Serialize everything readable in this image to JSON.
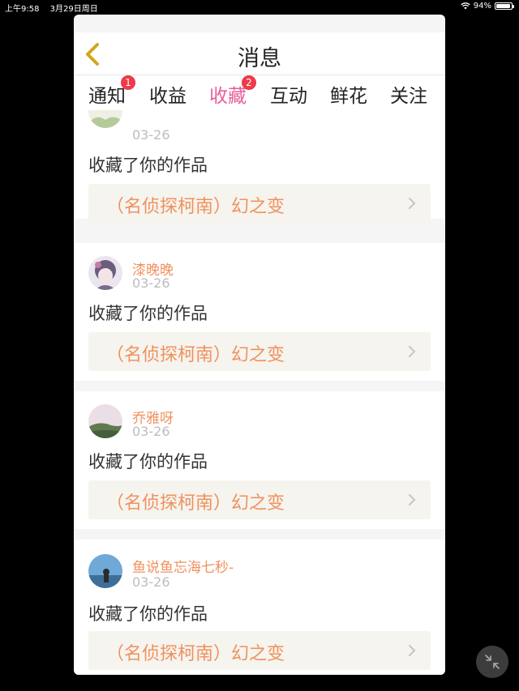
{
  "status_bar": {
    "time": "上午9:58",
    "date": "3月29日周日",
    "battery": "94%",
    "battery_level": 0.94,
    "icons": [
      "wifi-icon",
      "battery-icon"
    ]
  },
  "header": {
    "title": "消息",
    "back_icon": "chevron-left-icon"
  },
  "tabs": [
    {
      "label": "通知",
      "badge": "1",
      "active": false
    },
    {
      "label": "收益",
      "badge": null,
      "active": false
    },
    {
      "label": "收藏",
      "badge": "2",
      "active": true
    },
    {
      "label": "互动",
      "badge": null,
      "active": false
    },
    {
      "label": "鲜花",
      "badge": null,
      "active": false
    },
    {
      "label": "关注",
      "badge": null,
      "active": false
    }
  ],
  "items": [
    {
      "user": "",
      "date": "03-26",
      "text": "收藏了你的作品",
      "work": "（名侦探柯南）幻之变"
    },
    {
      "user": "漆晚晚",
      "date": "03-26",
      "text": "收藏了你的作品",
      "work": "（名侦探柯南）幻之变"
    },
    {
      "user": "乔雅呀",
      "date": "03-26",
      "text": "收藏了你的作品",
      "work": "（名侦探柯南）幻之变"
    },
    {
      "user": "鱼说鱼忘海七秒-",
      "date": "03-26",
      "text": "收藏了你的作品",
      "work": "（名侦探柯南）幻之变"
    }
  ],
  "colors": {
    "accent": "#e85d9c",
    "username": "#f0915f",
    "badge": "#ef3a4a",
    "back_icon": "#d4a51c"
  },
  "fab_icon": "collapse-icon"
}
